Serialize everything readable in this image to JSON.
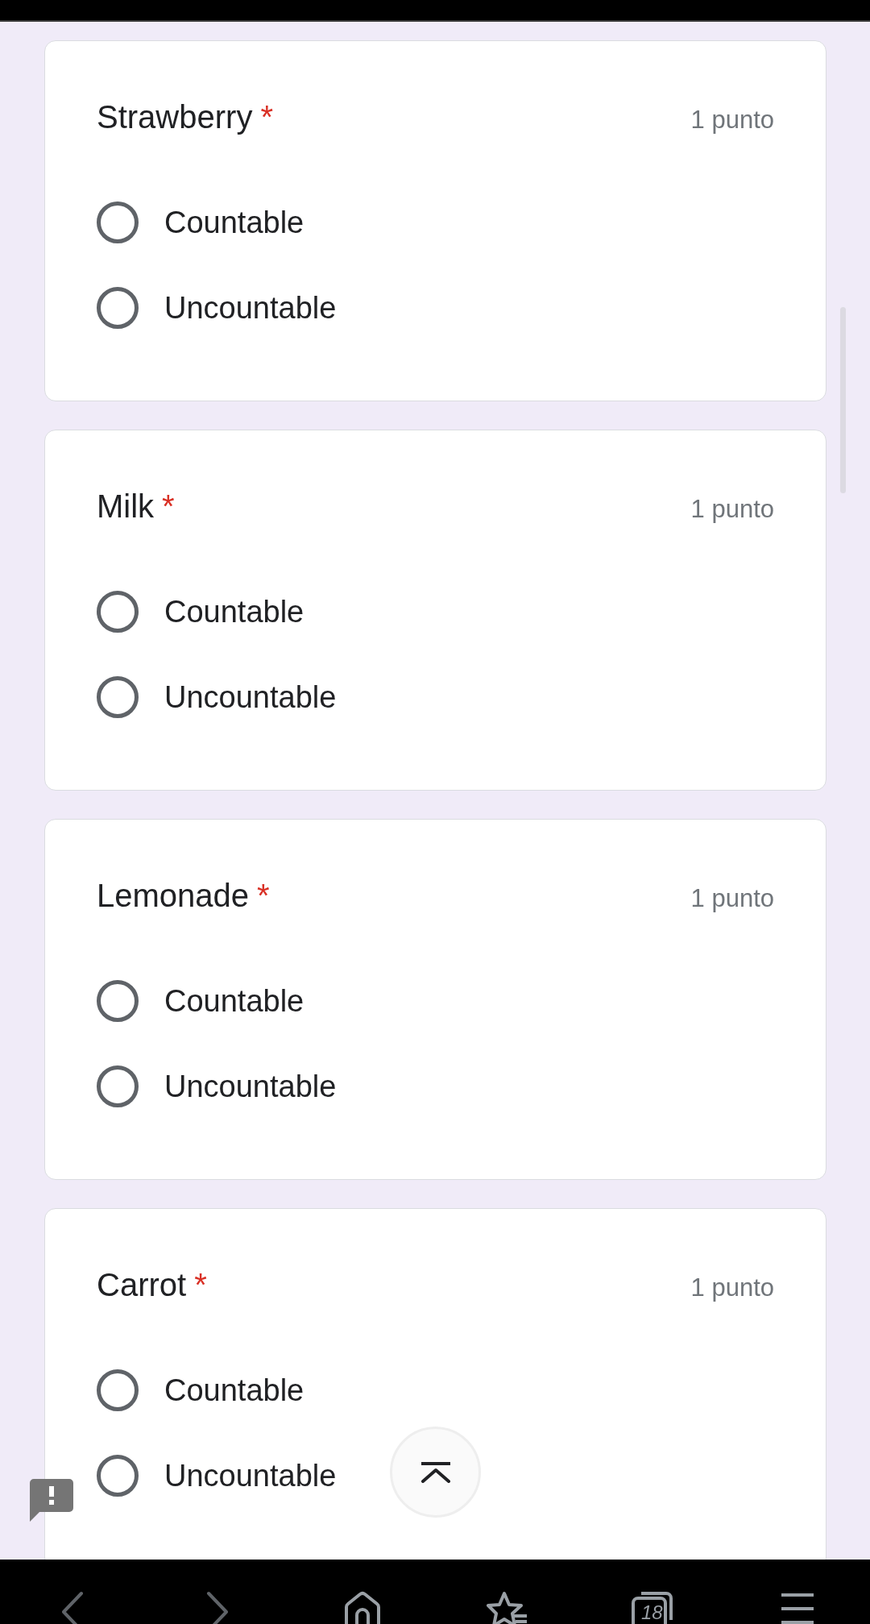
{
  "questions": [
    {
      "title": "Strawberry",
      "required_mark": "*",
      "points": "1 punto",
      "options": [
        {
          "label": "Countable",
          "selected": false
        },
        {
          "label": "Uncountable",
          "selected": false
        }
      ]
    },
    {
      "title": "Milk",
      "required_mark": "*",
      "points": "1 punto",
      "options": [
        {
          "label": "Countable",
          "selected": false
        },
        {
          "label": "Uncountable",
          "selected": false
        }
      ]
    },
    {
      "title": "Lemonade",
      "required_mark": "*",
      "points": "1 punto",
      "options": [
        {
          "label": "Countable",
          "selected": false
        },
        {
          "label": "Uncountable",
          "selected": false
        }
      ]
    },
    {
      "title": "Carrot",
      "required_mark": "*",
      "points": "1 punto",
      "options": [
        {
          "label": "Countable",
          "selected": false
        },
        {
          "label": "Uncountable",
          "selected": false
        }
      ]
    }
  ],
  "nav_bar": {
    "tab_count": "18"
  }
}
